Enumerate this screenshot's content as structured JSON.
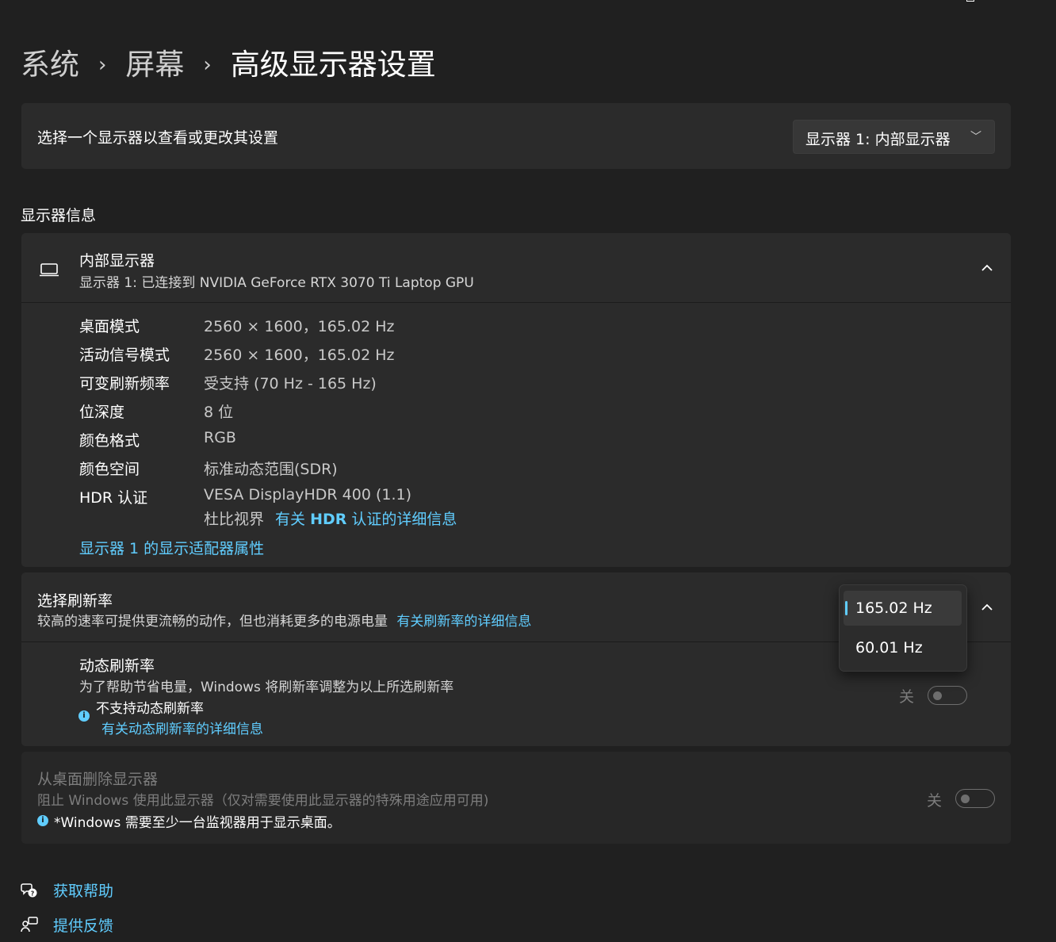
{
  "breadcrumb": {
    "items": [
      "系统",
      "屏幕",
      "高级显示器设置"
    ],
    "separator": "›"
  },
  "display_select": {
    "label": "选择一个显示器以查看或更改其设置",
    "value": "显示器 1: 内部显示器"
  },
  "section_title": "显示器信息",
  "display_info": {
    "title": "内部显示器",
    "subtitle": "显示器 1: 已连接到 NVIDIA GeForce RTX 3070 Ti Laptop GPU",
    "properties": [
      {
        "label": "桌面模式",
        "value": "2560 × 1600，165.02 Hz"
      },
      {
        "label": "活动信号模式",
        "value": "2560 × 1600，165.02 Hz"
      },
      {
        "label": "可变刷新频率",
        "value": "受支持 (70 Hz - 165 Hz)"
      },
      {
        "label": "位深度",
        "value": "8 位"
      },
      {
        "label": "颜色格式",
        "value": "RGB"
      },
      {
        "label": "颜色空间",
        "value": "标准动态范围(SDR)"
      },
      {
        "label": "HDR 认证",
        "value": "VESA DisplayHDR 400 (1.1)"
      }
    ],
    "dolby_text": "杜比视界",
    "hdr_link_prefix": "有关",
    "hdr_link_bold": "HDR",
    "hdr_link_suffix": "认证的详细信息",
    "adapter_link": "显示器 1 的显示适配器属性"
  },
  "refresh_rate": {
    "title": "选择刷新率",
    "description": "较高的速率可提供更流畅的动作，但也消耗更多的电源电量",
    "details_link": "有关刷新率的详细信息",
    "options": [
      "165.02 Hz",
      "60.01 Hz"
    ],
    "dynamic": {
      "title": "动态刷新率",
      "description": "为了帮助节省电量，Windows 将刷新率调整为以上所选刷新率",
      "note": "不支持动态刷新率",
      "link": "有关动态刷新率的详细信息",
      "toggle_label": "关"
    }
  },
  "remove_display": {
    "title": "从桌面删除显示器",
    "description": "阻止 Windows 使用此显示器（仅对需要使用此显示器的特殊用途应用可用)",
    "note": "*Windows 需要至少一台监视器用于显示桌面。",
    "toggle_label": "关"
  },
  "footer": {
    "help": "获取帮助",
    "feedback": "提供反馈"
  },
  "colors": {
    "background": "#202020",
    "card": "#2b2b2b",
    "accent": "#60cdff"
  }
}
